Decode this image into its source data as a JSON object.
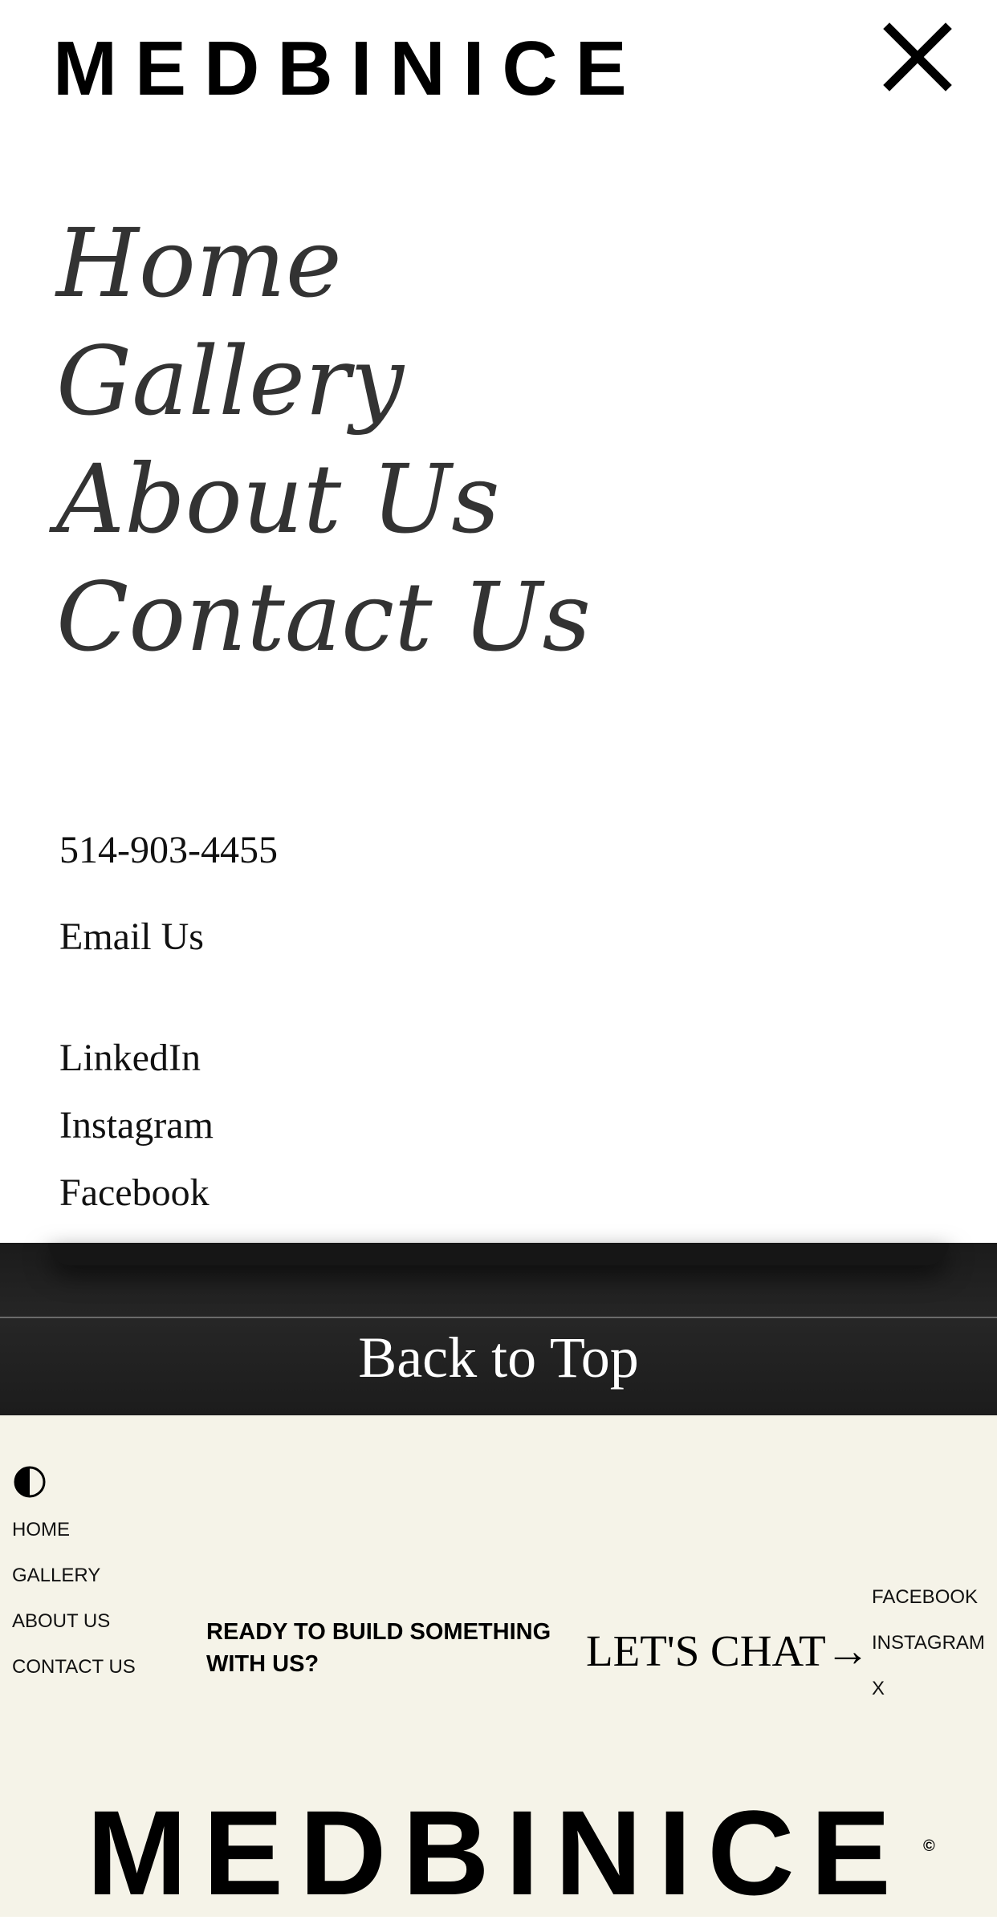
{
  "header": {
    "logo": "MEDBINICE",
    "close_icon": "close-icon"
  },
  "menu": {
    "items": [
      {
        "label": "Home"
      },
      {
        "label": "Gallery"
      },
      {
        "label": "About Us"
      },
      {
        "label": "Contact Us"
      }
    ]
  },
  "contact": {
    "phone": "514-903-4455",
    "email": "Email Us"
  },
  "social": {
    "items": [
      {
        "label": "LinkedIn"
      },
      {
        "label": "Instagram"
      },
      {
        "label": "Facebook"
      }
    ]
  },
  "back_to_top": "Back to Top",
  "footer": {
    "theme_icon": "contrast-icon",
    "nav": [
      "HOME",
      "GALLERY",
      "ABOUT US",
      "CONTACT US"
    ],
    "cta_line1": "READY TO BUILD SOMETHING",
    "cta_line2": "WITH US?",
    "chat_label": "LET'S CHAT→",
    "social": [
      "FACEBOOK",
      "INSTAGRAM",
      "X"
    ],
    "logo": "MEDBINICE",
    "copyright": "©"
  },
  "colors": {
    "footer_bg": "#f5f3e8",
    "dark_band": "#1f1f1f",
    "menu_text": "#333333"
  }
}
